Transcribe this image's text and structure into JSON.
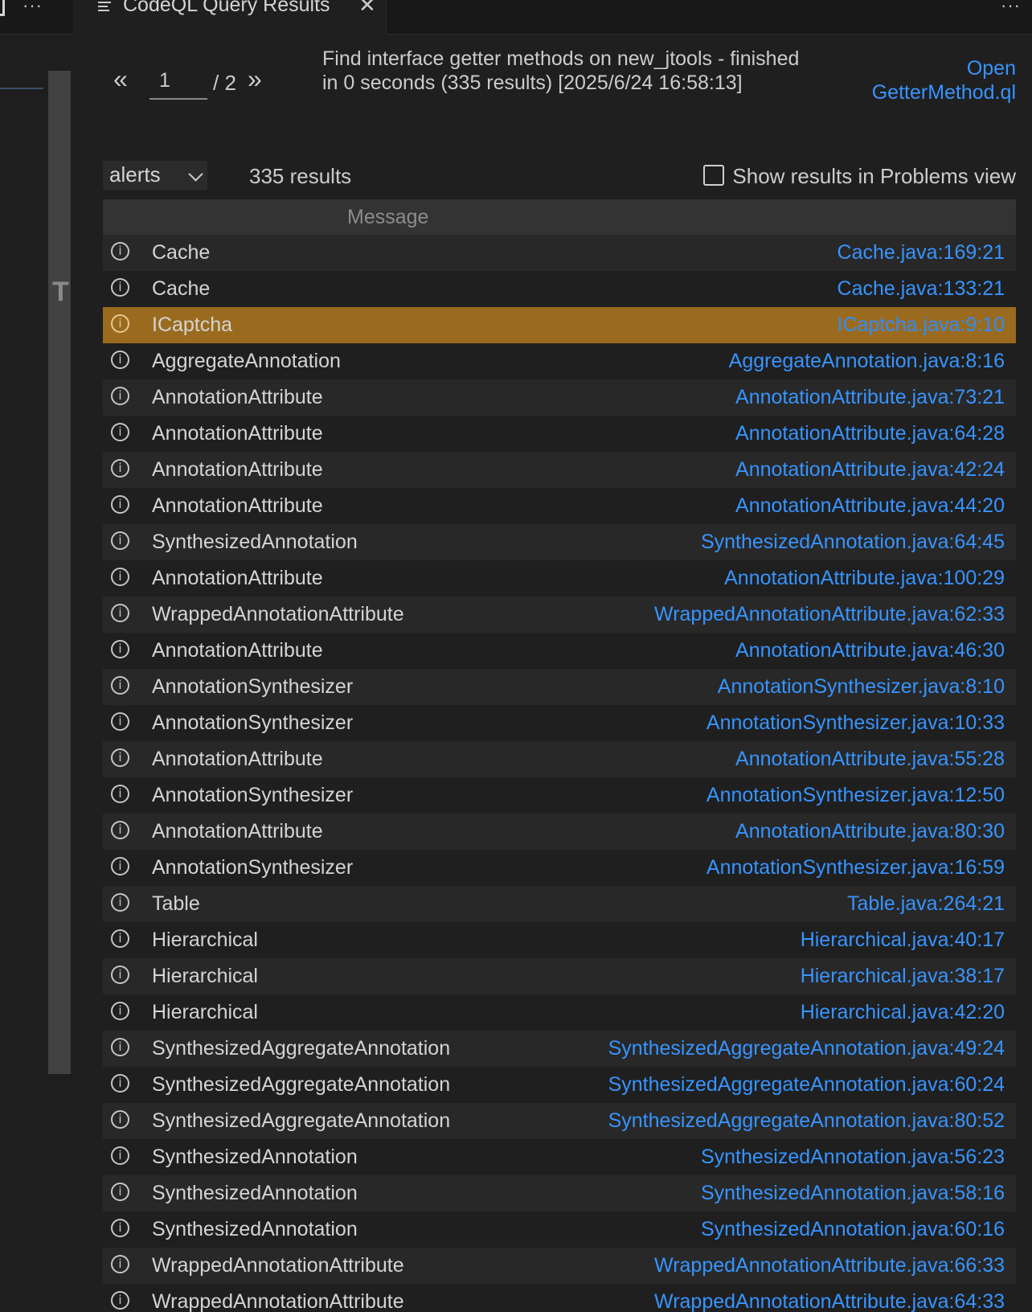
{
  "left_editor": {
    "more_icon": "ellipsis-icon"
  },
  "tab": {
    "icon": "list-icon",
    "title": "CodeQL Query Results",
    "close_icon": "close-icon"
  },
  "panel_more_icon": "ellipsis-icon",
  "pager": {
    "prev_label": "«",
    "current_page": "1",
    "total_label": "/ 2",
    "next_label": "»"
  },
  "query": {
    "description": "Find interface getter methods on new_jtools - finished in 0 seconds (335 results) [2025/6/24 16:58:13]",
    "open_link_line1": "Open",
    "open_link_line2": "GetterMethod.ql"
  },
  "toolbar": {
    "result_set": "alerts",
    "result_count": "335 results",
    "show_in_problems_label": "Show results in Problems view",
    "show_in_problems_checked": false
  },
  "table": {
    "header_message": "Message",
    "selected_index": 2,
    "colors": {
      "row": "#1f1f1f",
      "row_alt": "#282828",
      "selected": "#9a6b1e",
      "link": "#3794ff"
    },
    "rows": [
      {
        "message": "Cache",
        "location": "Cache.java:169:21"
      },
      {
        "message": "Cache",
        "location": "Cache.java:133:21"
      },
      {
        "message": "ICaptcha",
        "location": "ICaptcha.java:9:10"
      },
      {
        "message": "AggregateAnnotation",
        "location": "AggregateAnnotation.java:8:16"
      },
      {
        "message": "AnnotationAttribute",
        "location": "AnnotationAttribute.java:73:21"
      },
      {
        "message": "AnnotationAttribute",
        "location": "AnnotationAttribute.java:64:28"
      },
      {
        "message": "AnnotationAttribute",
        "location": "AnnotationAttribute.java:42:24"
      },
      {
        "message": "AnnotationAttribute",
        "location": "AnnotationAttribute.java:44:20"
      },
      {
        "message": "SynthesizedAnnotation",
        "location": "SynthesizedAnnotation.java:64:45"
      },
      {
        "message": "AnnotationAttribute",
        "location": "AnnotationAttribute.java:100:29"
      },
      {
        "message": "WrappedAnnotationAttribute",
        "location": "WrappedAnnotationAttribute.java:62:33"
      },
      {
        "message": "AnnotationAttribute",
        "location": "AnnotationAttribute.java:46:30"
      },
      {
        "message": "AnnotationSynthesizer",
        "location": "AnnotationSynthesizer.java:8:10"
      },
      {
        "message": "AnnotationSynthesizer",
        "location": "AnnotationSynthesizer.java:10:33"
      },
      {
        "message": "AnnotationAttribute",
        "location": "AnnotationAttribute.java:55:28"
      },
      {
        "message": "AnnotationSynthesizer",
        "location": "AnnotationSynthesizer.java:12:50"
      },
      {
        "message": "AnnotationAttribute",
        "location": "AnnotationAttribute.java:80:30"
      },
      {
        "message": "AnnotationSynthesizer",
        "location": "AnnotationSynthesizer.java:16:59"
      },
      {
        "message": "Table",
        "location": "Table.java:264:21"
      },
      {
        "message": "Hierarchical",
        "location": "Hierarchical.java:40:17"
      },
      {
        "message": "Hierarchical",
        "location": "Hierarchical.java:38:17"
      },
      {
        "message": "Hierarchical",
        "location": "Hierarchical.java:42:20"
      },
      {
        "message": "SynthesizedAggregateAnnotation",
        "location": "SynthesizedAggregateAnnotation.java:49:24"
      },
      {
        "message": "SynthesizedAggregateAnnotation",
        "location": "SynthesizedAggregateAnnotation.java:60:24"
      },
      {
        "message": "SynthesizedAggregateAnnotation",
        "location": "SynthesizedAggregateAnnotation.java:80:52"
      },
      {
        "message": "SynthesizedAnnotation",
        "location": "SynthesizedAnnotation.java:56:23"
      },
      {
        "message": "SynthesizedAnnotation",
        "location": "SynthesizedAnnotation.java:58:16"
      },
      {
        "message": "SynthesizedAnnotation",
        "location": "SynthesizedAnnotation.java:60:16"
      },
      {
        "message": "WrappedAnnotationAttribute",
        "location": "WrappedAnnotationAttribute.java:66:33"
      },
      {
        "message": "WrappedAnnotationAttribute",
        "location": "WrappedAnnotationAttribute.java:64:33"
      }
    ]
  }
}
